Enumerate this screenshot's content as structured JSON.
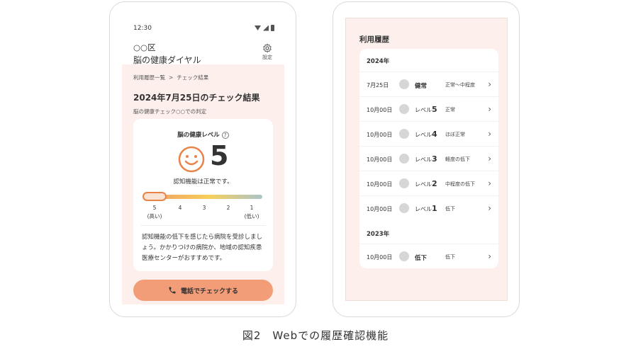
{
  "left": {
    "status": {
      "time": "12:30"
    },
    "header": {
      "ward": "○○区",
      "title": "脳の健康ダイヤル",
      "settings_label": "設定"
    },
    "breadcrumb": {
      "parent": "利用履歴一覧",
      "separator": ">",
      "current": "チェック結果"
    },
    "result": {
      "title": "2024年7月25日のチェック結果",
      "subtitle": "脳の健康チェック○○での判定",
      "level_label": "脳の健康レベル",
      "help": "?",
      "level": "5",
      "status_text": "認知機能は正常です。",
      "scale_level": 5,
      "scale_ticks": [
        "5",
        "4",
        "3",
        "2",
        "1"
      ],
      "scale_high": "(高い)",
      "scale_low": "(低い)",
      "advice": "認知機能の低下を感じたら病院を受診しましょう。かかりつけの病院か、地域の認知疾患医療センターがおすすめです。"
    },
    "call_button": "電話でチェックする"
  },
  "right": {
    "title": "利用履歴",
    "year_2024": "2024年",
    "year_2023": "2023年",
    "rows_2024": [
      {
        "date": "7月25日",
        "prefix": "",
        "level": "健常",
        "desc": "正常〜中程度"
      },
      {
        "date": "10月00日",
        "prefix": "レベル",
        "level": "5",
        "desc": "正常"
      },
      {
        "date": "10月00日",
        "prefix": "レベル",
        "level": "4",
        "desc": "ほぼ正常"
      },
      {
        "date": "10月00日",
        "prefix": "レベル",
        "level": "3",
        "desc": "軽度の低下"
      },
      {
        "date": "10月00日",
        "prefix": "レベル",
        "level": "2",
        "desc": "中程度の低下"
      },
      {
        "date": "10月00日",
        "prefix": "レベル",
        "level": "1",
        "desc": "低下"
      }
    ],
    "rows_2023": [
      {
        "date": "10月00日",
        "prefix": "",
        "level": "低下",
        "desc": "低下"
      }
    ]
  },
  "caption": "図2　Webでの履歴確認機能",
  "colors": {
    "accent": "#f29d78",
    "screen_bg": "#fdf0ec",
    "smile": "#e8834a"
  },
  "icons": [
    "wifi-icon",
    "signal-icon",
    "battery-icon",
    "gear-icon",
    "help-icon",
    "smile-icon",
    "phone-icon",
    "chevron-right-icon",
    "chevron-right-small-icon"
  ]
}
